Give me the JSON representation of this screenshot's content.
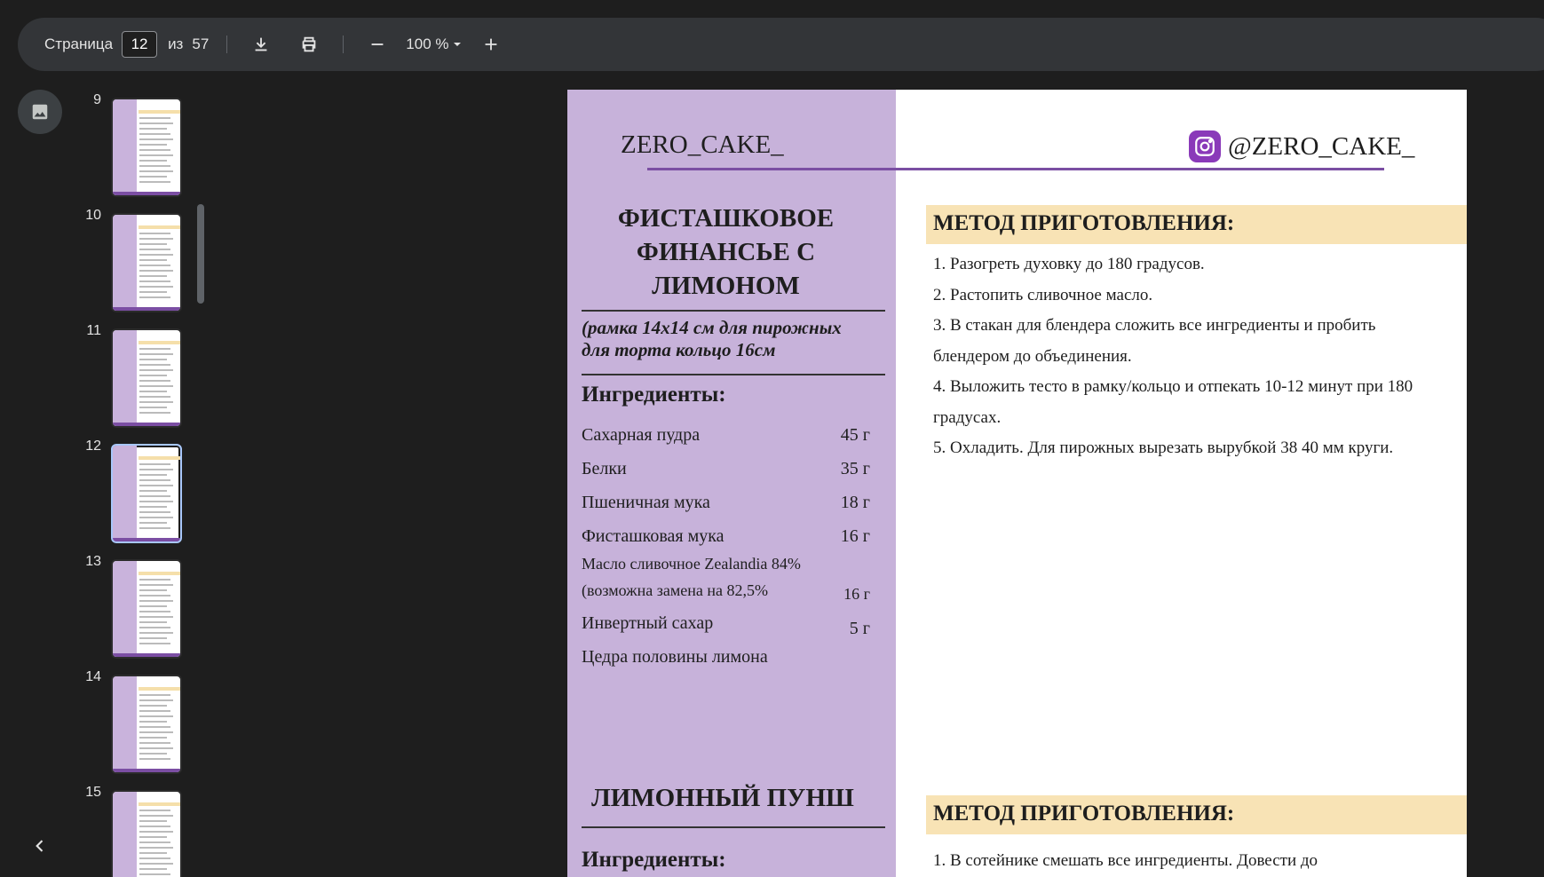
{
  "toolbar": {
    "page_label": "Страница",
    "page_current": "12",
    "page_of": "из",
    "page_total": "57",
    "zoom": "100 %"
  },
  "thumbnails": [
    {
      "num": "9"
    },
    {
      "num": "10"
    },
    {
      "num": "11"
    },
    {
      "num": "12",
      "active": true
    },
    {
      "num": "13"
    },
    {
      "num": "14"
    },
    {
      "num": "15"
    }
  ],
  "page": {
    "brand": "ZERO_CAKE_",
    "instagram_handle": "@ZERO_CAKE_",
    "recipe1": {
      "title_line1": "ФИСТАШКОВОЕ",
      "title_line2": "ФИНАНСЬЕ С",
      "title_line3": "ЛИМОНОМ",
      "subtitle_line1": "(рамка 14х14 см для пирожных",
      "subtitle_line2": "для торта кольцо 16см",
      "ingredients_heading": "Ингредиенты:",
      "ingredients": [
        {
          "name": "Сахарная пудра",
          "qty": "45 г"
        },
        {
          "name": "Белки",
          "qty": "35 г"
        },
        {
          "name": "Пшеничная мука",
          "qty": "18 г"
        },
        {
          "name": "Фисташковая мука",
          "qty": "16 г"
        },
        {
          "name": "Масло сливочное Zealandia 84%",
          "qty": ""
        },
        {
          "name": "(возможна замена на 82,5%",
          "qty": "16 г"
        },
        {
          "name": "Инвертный сахар",
          "qty": "5 г"
        },
        {
          "name": "Цедра половины лимона",
          "qty": ""
        }
      ],
      "method_heading": "МЕТОД ПРИГОТОВЛЕНИЯ:",
      "steps": [
        "1. Разогреть духовку до 180 градусов.",
        "2. Растопить сливочное масло.",
        "3. В стакан для блендера сложить все ингредиенты и пробить блендером до объединения.",
        "4. Выложить тесто в рамку/кольцо и отпекать 10-12 минут при 180 градусах.",
        "5. Охладить. Для пирожных вырезать вырубкой 38 40 мм круги."
      ]
    },
    "recipe2": {
      "title": "ЛИМОННЫЙ ПУНШ",
      "ingredients_heading": "Ингредиенты:",
      "method_heading": "МЕТОД ПРИГОТОВЛЕНИЯ:",
      "steps": [
        "1. В сотейнике смешать все ингредиенты. Довести до"
      ]
    }
  }
}
